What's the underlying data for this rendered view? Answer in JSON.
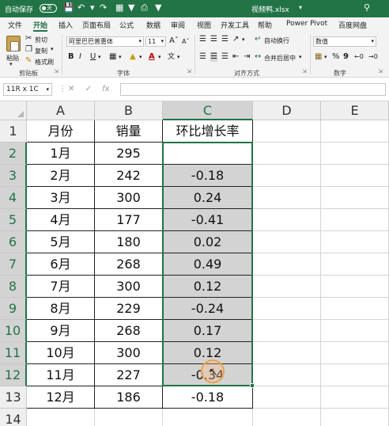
{
  "titlebar": {
    "autosave_label": "自动保存",
    "toggle_state": "关",
    "filename": "视频鸭.xlsx",
    "dropdown_glyph": "▾"
  },
  "tabs": [
    "文件",
    "开始",
    "插入",
    "页面布局",
    "公式",
    "数据",
    "审阅",
    "视图",
    "开发工具",
    "帮助",
    "Power Pivot",
    "百度网盘"
  ],
  "active_tab": "开始",
  "ribbon": {
    "paste_label": "粘贴",
    "cut_label": "剪切",
    "copy_label": "复制",
    "format_painter_label": "格式刷",
    "clipboard_group": "剪贴板",
    "font_name": "阿里巴巴普惠体",
    "font_size": "11",
    "bold": "B",
    "italic": "I",
    "underline": "U",
    "font_color_glyph": "A",
    "font_group": "字体",
    "wrap_text_label": "自动换行",
    "merge_center_label": "合并后居中",
    "alignment_group": "对齐方式",
    "number_format": "数值",
    "percent_glyph": "%",
    "comma_glyph": "9",
    "number_group": "数字"
  },
  "formula_bar": {
    "name_box": "11R x 1C",
    "cancel_glyph": "✕",
    "enter_glyph": "✓",
    "fx_label": "fx",
    "formula": ""
  },
  "columns": [
    "A",
    "B",
    "C",
    "D",
    "E"
  ],
  "selected_column": "C",
  "rows": [
    {
      "num": "1",
      "a": "月份",
      "b": "销量",
      "c": "环比增长率"
    },
    {
      "num": "2",
      "a": "1月",
      "b": "295",
      "c": ""
    },
    {
      "num": "3",
      "a": "2月",
      "b": "242",
      "c": "-0.18"
    },
    {
      "num": "4",
      "a": "3月",
      "b": "300",
      "c": "0.24"
    },
    {
      "num": "5",
      "a": "4月",
      "b": "177",
      "c": "-0.41"
    },
    {
      "num": "6",
      "a": "5月",
      "b": "180",
      "c": "0.02"
    },
    {
      "num": "7",
      "a": "6月",
      "b": "268",
      "c": "0.49"
    },
    {
      "num": "8",
      "a": "7月",
      "b": "300",
      "c": "0.12"
    },
    {
      "num": "9",
      "a": "8月",
      "b": "229",
      "c": "-0.24"
    },
    {
      "num": "10",
      "a": "9月",
      "b": "268",
      "c": "0.17"
    },
    {
      "num": "11",
      "a": "10月",
      "b": "300",
      "c": "0.12"
    },
    {
      "num": "12",
      "a": "11月",
      "b": "227",
      "c": "-0.34"
    },
    {
      "num": "13",
      "a": "12月",
      "b": "186",
      "c": "-0.18"
    },
    {
      "num": "14",
      "a": "",
      "b": "",
      "c": ""
    }
  ],
  "colors": {
    "excel_green": "#217346",
    "selection_fill": "#d3d3d3",
    "cursor_highlight": "#f0a050"
  }
}
